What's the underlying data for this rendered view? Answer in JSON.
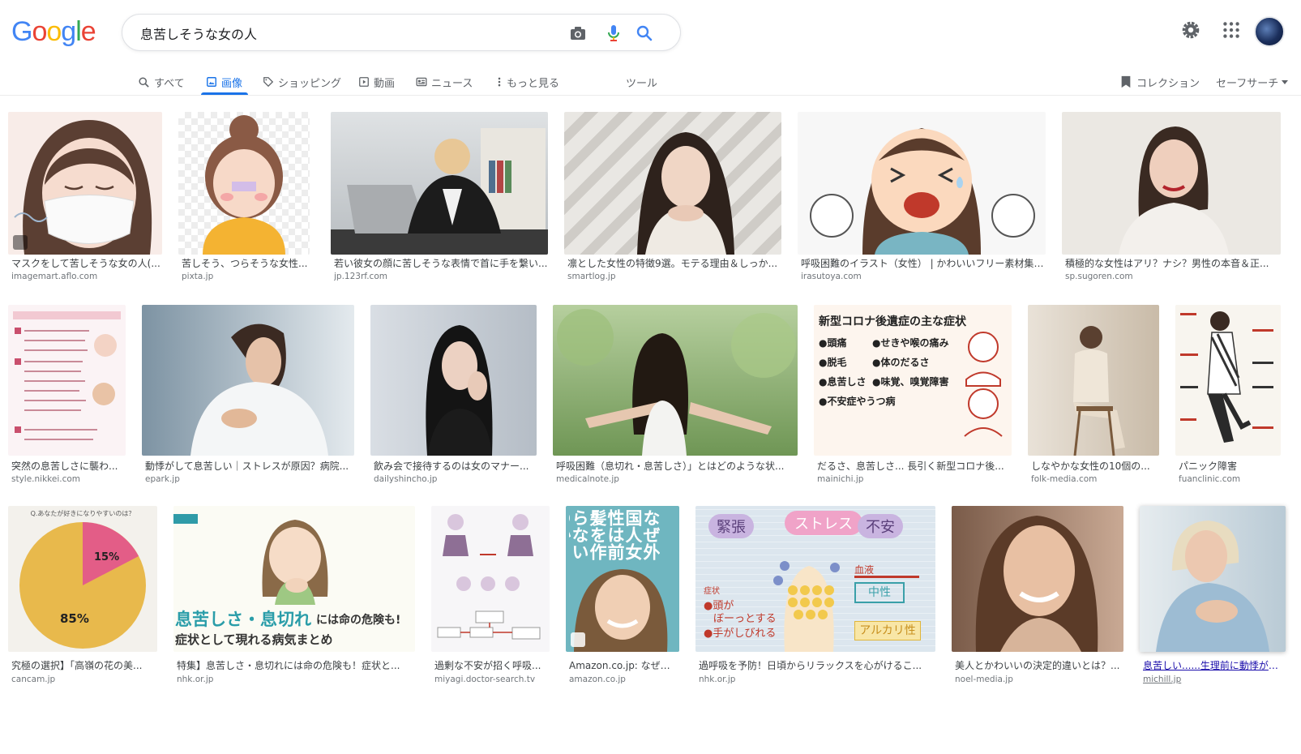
{
  "logo": {
    "letters": [
      "G",
      "o",
      "o",
      "g",
      "l",
      "e"
    ],
    "colors": [
      "#4285F4",
      "#EA4335",
      "#FBBC05",
      "#4285F4",
      "#34A853",
      "#EA4335"
    ]
  },
  "search": {
    "query": "息苦しそうな女の人"
  },
  "tabs": [
    {
      "label": "すべて",
      "icon": "search-icon"
    },
    {
      "label": "画像",
      "icon": "image-icon"
    },
    {
      "label": "ショッピング",
      "icon": "tag-icon"
    },
    {
      "label": "動画",
      "icon": "play-icon"
    },
    {
      "label": "ニュース",
      "icon": "news-icon"
    },
    {
      "label": "もっと見る",
      "icon": "more-vert-icon"
    },
    {
      "label": "ツール",
      "icon": ""
    }
  ],
  "right": {
    "collection": "コレクション",
    "safesearch": "セーフサーチ"
  },
  "colors": {
    "accent": "#1a73e8"
  },
  "rows": [
    [
      {
        "caption": "マスクをして苦しそうな女の人(...",
        "source": "imagemart.aflo.com",
        "bg": "#f5e8e4"
      },
      {
        "caption": "苦しそう、つらそうな女性...",
        "source": "pixta.jp",
        "bg": "#eaeaea"
      },
      {
        "caption": "若い彼女の顔に苦しそうな表情で首に手を繋い...",
        "source": "jp.123rf.com",
        "bg": "#c9cdd1"
      },
      {
        "caption": "凛とした女性の特徴9選。モテる理由＆しっか...",
        "source": "smartlog.jp",
        "bg": "#d8d6d2"
      },
      {
        "caption": "呼吸困難のイラスト（女性） | かわいいフリー素材集 ...",
        "source": "irasutoya.com",
        "bg": "#f6f6f6"
      },
      {
        "caption": "積極的な女性はアリ？ナシ？男性の本音＆正...",
        "source": "sp.sugoren.com",
        "bg": "#e4e1dc"
      }
    ],
    [
      {
        "caption": "突然の息苦しさに襲わ...",
        "source": "style.nikkei.com",
        "bg": "#f6ecef"
      },
      {
        "caption": "動悸がして息苦しい｜ストレスが原因？病院...",
        "source": "epark.jp",
        "bg": "#b9c6cf"
      },
      {
        "caption": "飲み会で接待するのは女のマナー...",
        "source": "dailyshincho.jp",
        "bg": "#c8cfd7"
      },
      {
        "caption": "呼吸困難（息切れ・息苦しさ）」とはどのような状...",
        "source": "medicalnote.jp",
        "bg": "#8fae7a"
      },
      {
        "caption": "だるさ、息苦しさ... 長引く新型コロナ後...",
        "source": "mainichi.jp",
        "bg": "#fdf4ec"
      },
      {
        "caption": "しなやかな女性の10個の...",
        "source": "folk-media.com",
        "bg": "#d7cbbd"
      },
      {
        "caption": "パニック障害",
        "source": "fuanclinic.com",
        "bg": "#f7f4ee"
      }
    ],
    [
      {
        "caption": "究極の選択】「高嶺の花の美...",
        "source": "cancam.jp",
        "bg": "#f1efe9"
      },
      {
        "caption": "特集】息苦しさ・息切れには命の危険も！症状と...",
        "source": "nhk.or.jp",
        "bg": "#fbfbf6"
      },
      {
        "caption": "過剰な不安が招く呼吸...",
        "source": "miyagi.doctor-search.tv",
        "bg": "#f6f5f7"
      },
      {
        "caption": "Amazon.co.jp: なぜ外...",
        "source": "amazon.co.jp",
        "bg": "#6fb6c0"
      },
      {
        "caption": "過呼吸を予防！日頃からリラックスを心がけるこ...",
        "source": "nhk.or.jp",
        "bg": "#dde7ee"
      },
      {
        "caption": "美人とかわいいの決定的違いとは？...",
        "source": "noel-media.jp",
        "bg": "#b08e7a"
      },
      {
        "caption": "息苦しい......生理前に動悸が起こ...",
        "source": "michill.jp",
        "bg": "#c4d5df"
      }
    ]
  ],
  "texts": {
    "pie_title": "Q.あなたが好きになりやすいのは？",
    "pie_small": "15%",
    "pie_big": "85%",
    "covid_title": "新型コロナ後遺症の主な症状",
    "covid_items": [
      "●頭痛",
      "●せきや喉の痛み",
      "●脱毛",
      "●体のだるさ",
      "●息苦しさ",
      "●味覚、嗅覚障害",
      "●不安症やうつ病"
    ],
    "nhk_banner": "息苦しさ・息切れ",
    "nhk_banner2": "には命の危険も!",
    "nhk_sub": "症状として現れる病気まとめ",
    "book_title": "なぜ外国人女性は前髪を作らないのか",
    "stress_words": [
      "緊張",
      "ストレス",
      "不安"
    ],
    "stress_labels": [
      "血液",
      "中性",
      "アルカリ性"
    ],
    "stress_sym": [
      "症状",
      "●頭が",
      "ぼーっとする",
      "●手がしびれる"
    ]
  }
}
